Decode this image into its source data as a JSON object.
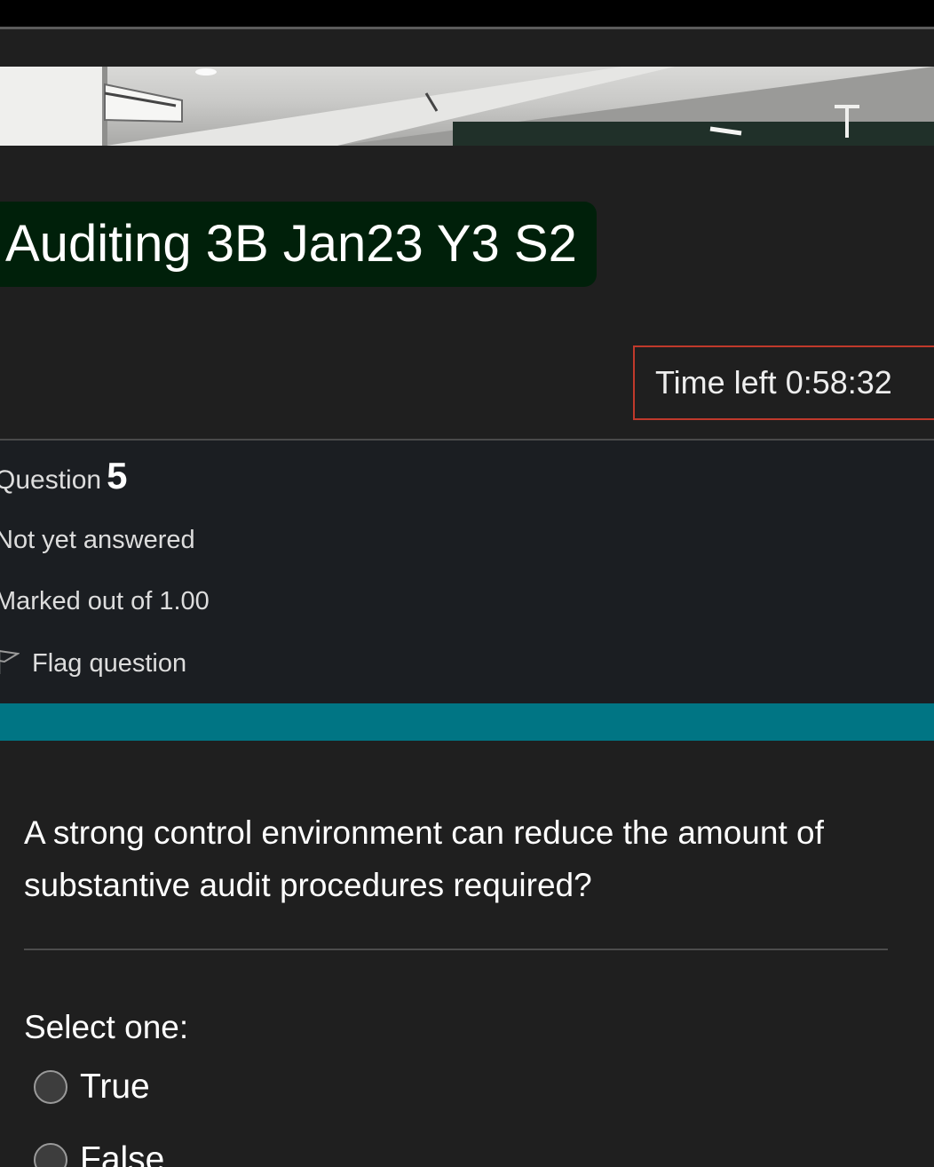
{
  "course": {
    "title": "Auditing 3B Jan23 Y3 S2"
  },
  "timer": {
    "label": "Time left 0:58:32"
  },
  "question_info": {
    "number_label": "Question",
    "number": "5",
    "state": "Not yet answered",
    "grade": "Marked out of 1.00",
    "flag_label": "Flag question",
    "flag_icon": "flag-outline-icon"
  },
  "question": {
    "text": "A strong control environment can reduce the amount of substantive audit procedures required?",
    "prompt": "Select one:",
    "options": [
      {
        "label": "True",
        "selected": false
      },
      {
        "label": "False",
        "selected": false
      }
    ]
  },
  "colors": {
    "title_badge": "#00200a",
    "timer_border": "#c0392b",
    "teal_bar": "#007584",
    "background": "#1f1f1f"
  }
}
